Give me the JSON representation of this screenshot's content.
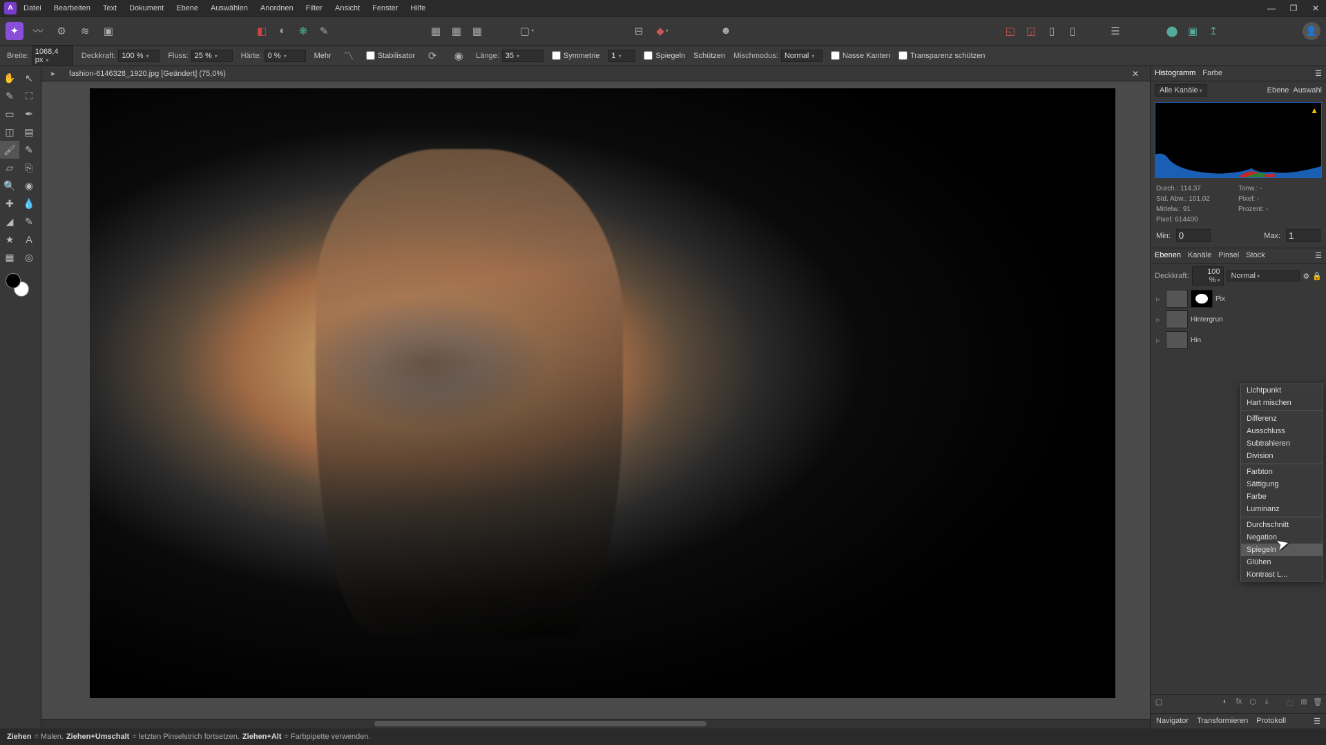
{
  "menu": {
    "items": [
      "Datei",
      "Bearbeiten",
      "Text",
      "Dokument",
      "Ebene",
      "Auswählen",
      "Anordnen",
      "Filter",
      "Ansicht",
      "Fenster",
      "Hilfe"
    ]
  },
  "window_controls": {
    "min": "—",
    "max": "❐",
    "close": "✕"
  },
  "context_bar": {
    "width_label": "Breite:",
    "width_value": "1068,4 px",
    "opacity_label": "Deckkraft:",
    "opacity_value": "100 %",
    "flow_label": "Fluss:",
    "flow_value": "25 %",
    "hardness_label": "Härte:",
    "hardness_value": "0 %",
    "more": "Mehr",
    "stabilizer": "Stabilisator",
    "length_label": "Länge:",
    "length_value": "35",
    "symmetry": "Symmetrie",
    "symmetry_value": "1",
    "mirror": "Spiegeln",
    "protect": "Schützen",
    "blendmode_label": "Mischmodus:",
    "blendmode_value": "Normal",
    "wet_edges": "Nasse Kanten",
    "protect_alpha": "Transparenz schützen"
  },
  "document": {
    "tab": "fashion-6146328_1920.jpg [Geändert] (75,0%)"
  },
  "histogram_panel": {
    "tabs": [
      "Histogramm",
      "Farbe"
    ],
    "channel_select": "Alle Kanäle",
    "layer_btn": "Ebene",
    "selection_btn": "Auswahl",
    "stats": {
      "mean_label": "Durch.:",
      "mean": "114.37",
      "stddev_label": "Std. Abw.:",
      "stddev": "101.02",
      "median_label": "Mittelw.:",
      "median": "91",
      "pixels_label": "Pixel:",
      "pixels": "614400",
      "tones_label": "Tonw.:",
      "tones": "-",
      "pixel2_label": "Pixel:",
      "pixel2": "-",
      "percent_label": "Prozent:",
      "percent": "-"
    },
    "min_label": "Min:",
    "min_value": "0",
    "max_label": "Max:",
    "max_value": "1"
  },
  "layers_panel": {
    "tabs": [
      "Ebenen",
      "Kanäle",
      "Pinsel",
      "Stock"
    ],
    "opacity_label": "Deckkraft:",
    "opacity_value": "100 %",
    "blend_value": "Normal",
    "layers": [
      {
        "name": "Pix"
      },
      {
        "name": "Hintergrun"
      },
      {
        "name": "Hin"
      }
    ]
  },
  "blend_menu": {
    "items_a": [
      "Lichtpunkt",
      "Hart mischen"
    ],
    "items_b": [
      "Differenz",
      "Ausschluss",
      "Subtrahieren",
      "Division"
    ],
    "items_c": [
      "Farbton",
      "Sättigung",
      "Farbe",
      "Luminanz"
    ],
    "items_d": [
      "Durchschnitt",
      "Negation",
      "Spiegeln",
      "Glühen",
      "Kontrast L..."
    ],
    "hovered": "Spiegeln"
  },
  "footer_tabs": [
    "Navigator",
    "Transformieren",
    "Protokoll"
  ],
  "statusbar": {
    "p1a": "Ziehen",
    "p1b": " = Malen. ",
    "p2a": "Ziehen+Umschalt",
    "p2b": " = letzten Pinselstrich fortsetzen. ",
    "p3a": "Ziehen+Alt",
    "p3b": " = Farbpipette verwenden."
  }
}
